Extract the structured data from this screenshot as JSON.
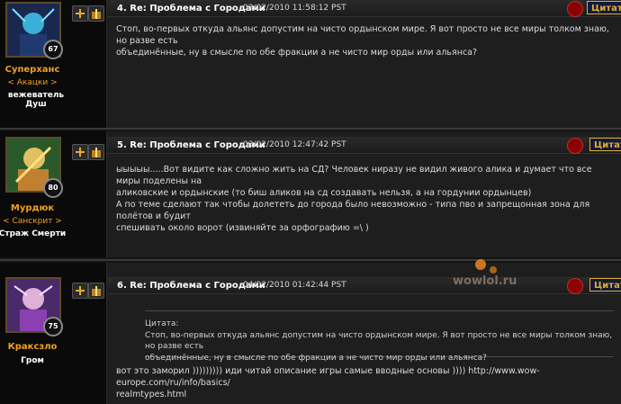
{
  "posts": [
    {
      "number_title": "4. Re: Проблема с Городами",
      "date": "03/02/2010 11:58:12 PST",
      "author": "Суперханс",
      "guild": "< Акацки >",
      "realm": "вежеватель Душ",
      "level": "67",
      "quote_label": "Цитата",
      "lines": [
        "Стоп, во-первых откуда альянс допустим на чисто ордынском мире. Я вот просто не все миры толком знаю, но разве есть",
        "объединённые, ну в смысле по обе фракции а не чисто мир орды или альянса?"
      ]
    },
    {
      "number_title": "5. Re: Проблема с Городами",
      "date": "03/02/2010 12:47:42 PST",
      "author": "Мурдюк",
      "guild": "< Санскрит >",
      "realm": "Страж Смерти",
      "level": "80",
      "quote_label": "Цитат",
      "lines": [
        "ыыыыы.....Вот видите как сложно жить на СД? Человек ниразу не видил живого алика и думает что все миры поделены на",
        "аликовские и ордынские (то биш аликов на сд создавать нельзя, а на гордунии ордынцев)",
        "А по теме сделают так чтобы долететь до города было невозможно - типа пво и запрещонная зона для полётов и будит",
        "спешивать около ворот (извиняйте за орфографию =\\ )"
      ]
    },
    {
      "number_title": "6. Re: Проблема с Городами",
      "date": "04/02/2010 01:42:44 PST",
      "author": "Краксзло",
      "guild": "",
      "realm": "Гром",
      "level": "75",
      "quote_label": "Цитат",
      "quote_heading": "Цитата:",
      "quote_lines": [
        "Стоп, во-первых откуда альянс допустим на чисто ордынском мире. Я вот просто не все миры толком знаю, но разве есть",
        "объединённые, ну в смысле по обе фракции а не чисто мир орды или альянса?"
      ],
      "lines": [
        "вот это заморил ))))))))) иди читай описание игры самые вводные основы )))) http://www.wow-europe.com/ru/info/basics/",
        "realmtypes.html"
      ]
    }
  ],
  "watermark": {
    "text": "wowlol.ru"
  },
  "colors": {
    "accent": "#f0a020",
    "quote_border": "#e0b030",
    "quote_bg": "#141a3a",
    "faction": "#8b0000"
  },
  "icons": [
    "plus-icon",
    "gift-icon",
    "horde-faction-icon"
  ]
}
